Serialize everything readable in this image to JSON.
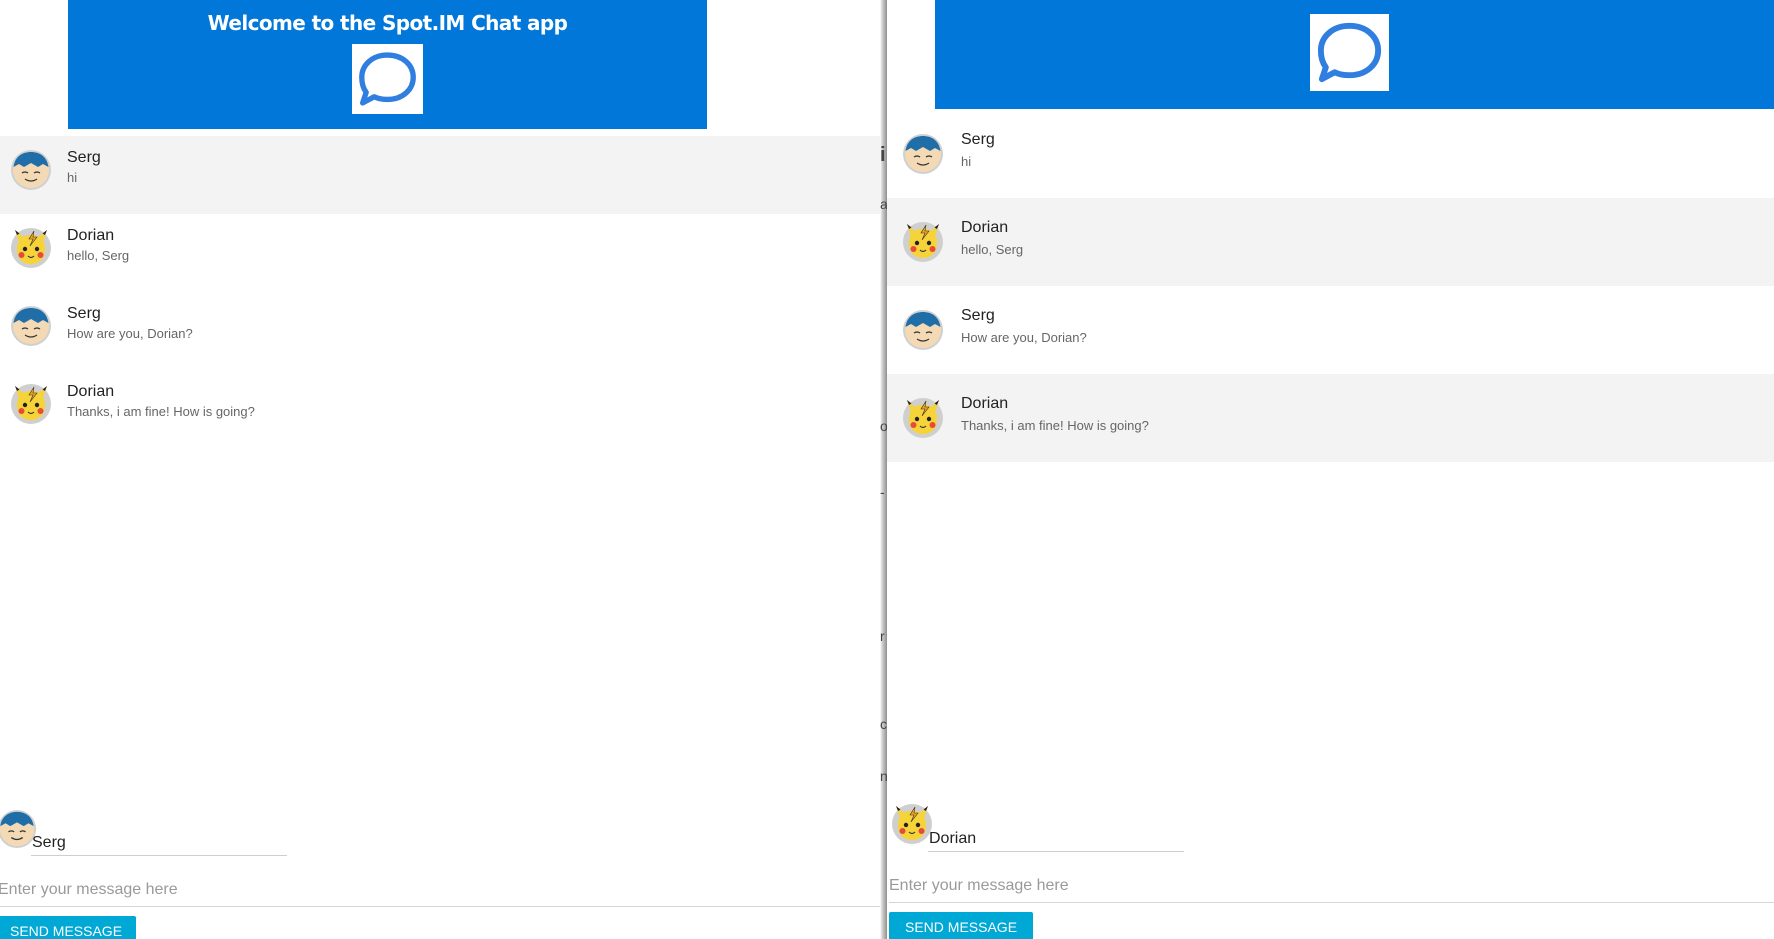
{
  "left": {
    "header": {
      "title": "Welcome to the Spot.IM Chat app",
      "logo": "chat-bubble-icon"
    },
    "messages": [
      {
        "author": "Serg",
        "text": "hi",
        "avatar": "snorlax-avatar"
      },
      {
        "author": "Dorian",
        "text": "hello, Serg",
        "avatar": "pikachu-avatar"
      },
      {
        "author": "Serg",
        "text": "How are you, Dorian?",
        "avatar": "snorlax-avatar"
      },
      {
        "author": "Dorian",
        "text": "Thanks, i am fine! How is going?",
        "avatar": "pikachu-avatar"
      }
    ],
    "composer": {
      "username": "Serg",
      "placeholder": "Enter your message here",
      "send_label": "SEND MESSAGE"
    }
  },
  "right": {
    "header": {
      "logo": "chat-bubble-icon"
    },
    "messages": [
      {
        "author": "Serg",
        "text": "hi",
        "avatar": "snorlax-avatar"
      },
      {
        "author": "Dorian",
        "text": "hello, Serg",
        "avatar": "pikachu-avatar"
      },
      {
        "author": "Serg",
        "text": "How are you, Dorian?",
        "avatar": "snorlax-avatar"
      },
      {
        "author": "Dorian",
        "text": "Thanks, i am fine! How is going?",
        "avatar": "pikachu-avatar"
      }
    ],
    "composer": {
      "username": "Dorian",
      "placeholder": "Enter your message here",
      "send_label": "SEND MESSAGE"
    }
  },
  "background_fragments": [
    "i",
    "a",
    "o",
    "-",
    "r",
    "c",
    "n"
  ],
  "colors": {
    "header": "#0077d9",
    "button": "#00a8d6",
    "alt_row": "#f3f3f3",
    "logo": "#2f7ee0"
  }
}
